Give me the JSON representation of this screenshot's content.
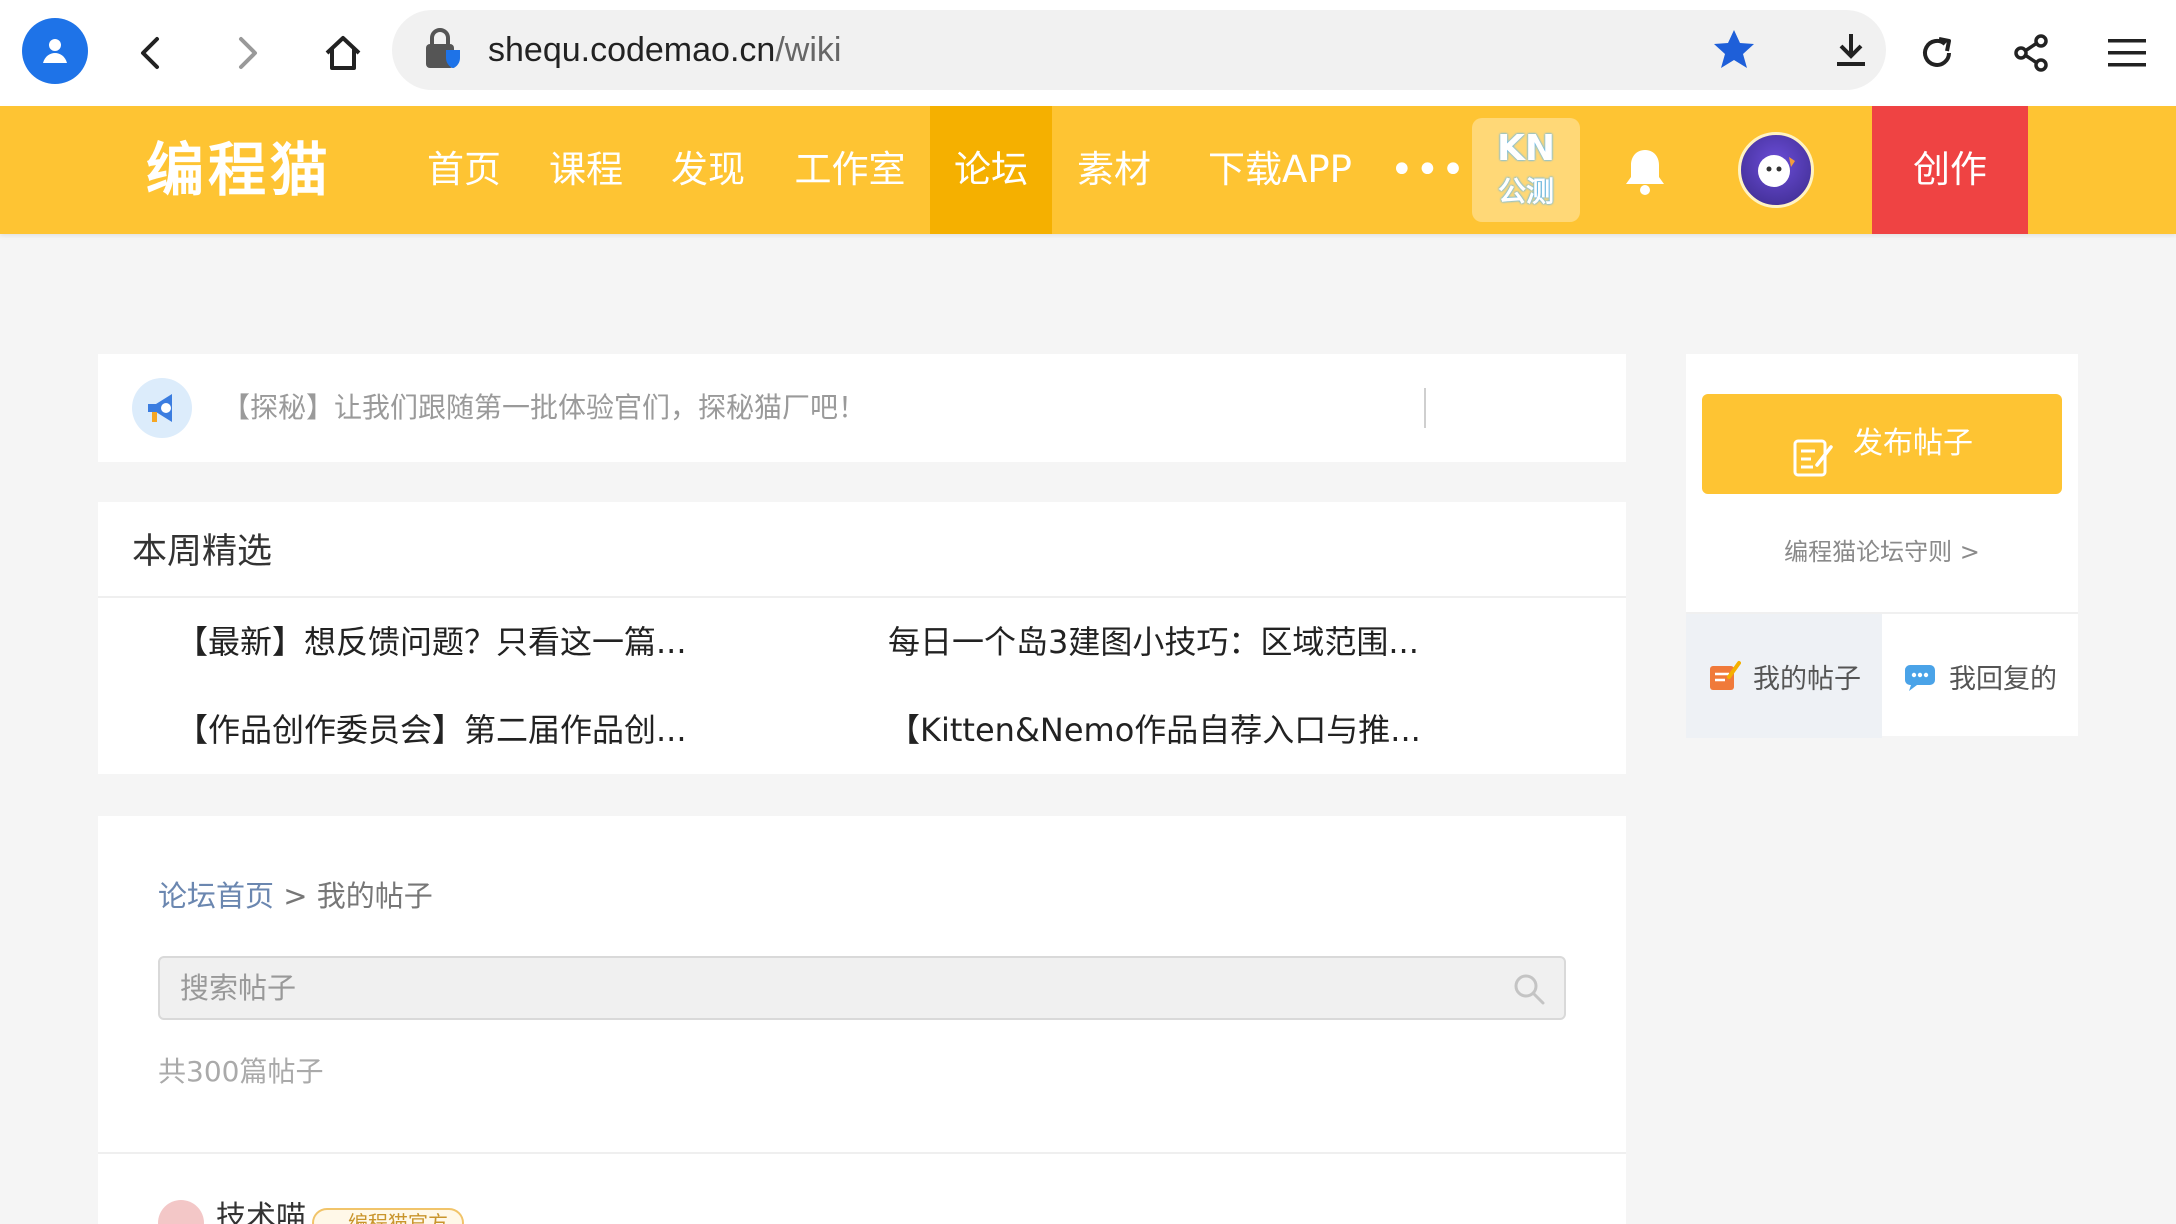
{
  "browser": {
    "url_host": "shequ.codemao.cn",
    "url_path": "/wiki",
    "icons": [
      "profile-icon",
      "back-icon",
      "forward-icon",
      "home-icon",
      "lock-icon",
      "star-icon",
      "download-icon",
      "reload-icon",
      "share-icon",
      "menu-icon"
    ]
  },
  "nav": {
    "logo": "编程猫",
    "items": [
      "首页",
      "课程",
      "发现",
      "工作室",
      "论坛",
      "素材",
      "下载APP"
    ],
    "active": "论坛",
    "more": "•••",
    "kn_badge": "KN",
    "kn_badge_sub": "公测",
    "create": "创作",
    "colors": {
      "bar": "#fec433",
      "active": "#f5b000",
      "create": "#ef4343"
    }
  },
  "announcement": {
    "text": "【探秘】让我们跟随第一批体验官们，探秘猫厂吧！"
  },
  "weekly": {
    "title": "本周精选",
    "links": [
      "【最新】想反馈问题？只看这一篇...",
      "每日一个岛3建图小技巧：区域范围...",
      "【作品创作委员会】第二届作品创...",
      "【Kitten&Nemo作品自荐入口与推..."
    ]
  },
  "posts": {
    "breadcrumb_home": "论坛首页",
    "breadcrumb_sep": " > ",
    "breadcrumb_current": "我的帖子",
    "search_placeholder": "搜索帖子",
    "count": "共300篇帖子",
    "first_author": "技术喵",
    "first_author_badge": "编程猫官方"
  },
  "sidebar": {
    "publish": "发布帖子",
    "rules": "编程猫论坛守则 >",
    "tab_mine": "我的帖子",
    "tab_replied": "我回复的"
  }
}
